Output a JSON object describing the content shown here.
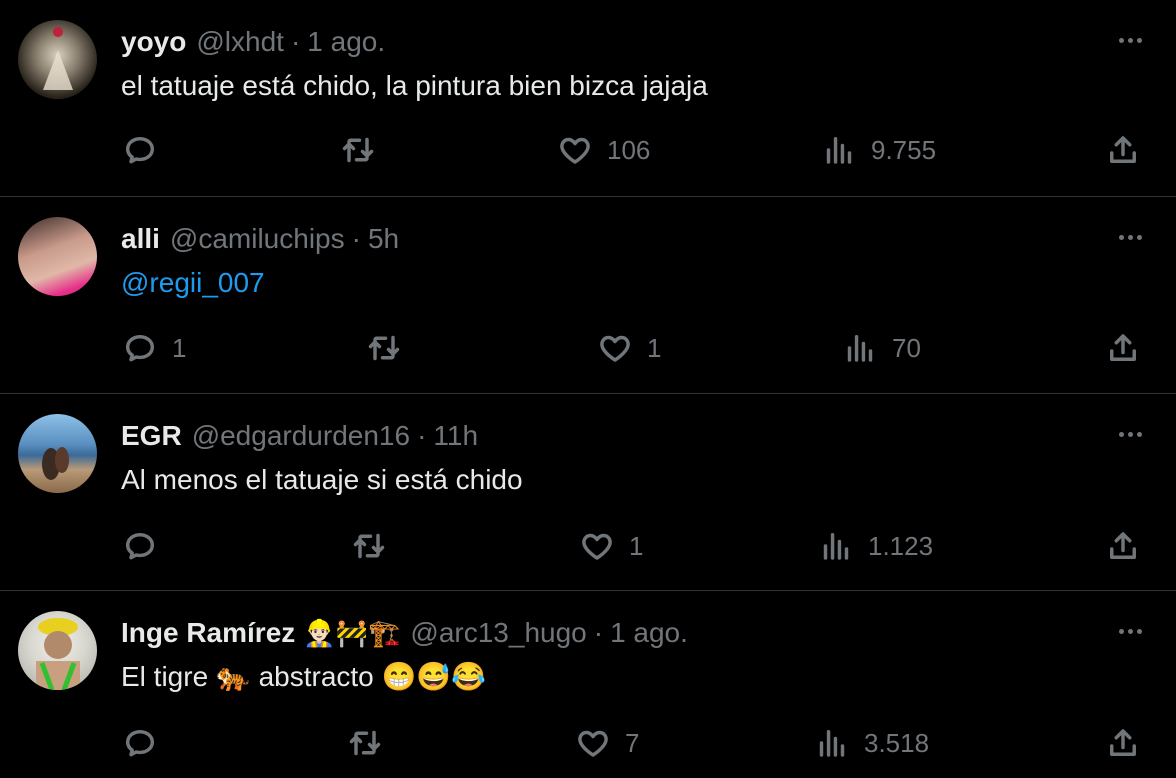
{
  "replies": [
    {
      "name": "yoyo",
      "emojis": "",
      "handle": "@lxhdt",
      "time": "1 ago.",
      "text": "el tatuaje está chido, la pintura bien bizca jajaja",
      "mention": "",
      "reply_count": "",
      "retweet_count": "",
      "like_count": "106",
      "view_count": "9.755",
      "avatar_colors": [
        "#3a3228",
        "#c9c0b0"
      ]
    },
    {
      "name": "alli",
      "emojis": "",
      "handle": "@camiluchips",
      "time": "5h",
      "text": "",
      "mention": "@regii_007",
      "reply_count": "1",
      "retweet_count": "",
      "like_count": "1",
      "view_count": "70",
      "avatar_colors": [
        "#d9b4a4",
        "#e83a8a"
      ]
    },
    {
      "name": "EGR",
      "emojis": "",
      "handle": "@edgardurden16",
      "time": "11h",
      "text": "Al menos el tatuaje si está chido",
      "mention": "",
      "reply_count": "",
      "retweet_count": "",
      "like_count": "1",
      "view_count": "1.123",
      "avatar_colors": [
        "#5a8fbf",
        "#b89a78"
      ]
    },
    {
      "name": "Inge Ramírez",
      "emojis": "👷🏻‍♂️🚧🏗️",
      "handle": "@arc13_hugo",
      "time": "1 ago.",
      "text": "El tigre 🐅 abstracto 😁😅😂",
      "mention": "",
      "reply_count": "",
      "retweet_count": "",
      "like_count": "7",
      "view_count": "3.518",
      "avatar_colors": [
        "#e0e0d8",
        "#3fbf3f"
      ]
    }
  ],
  "colors": {
    "background": "#000000",
    "text": "#e7e9ea",
    "muted": "#71767b",
    "link": "#1d9bf0",
    "divider": "#2f3336"
  }
}
